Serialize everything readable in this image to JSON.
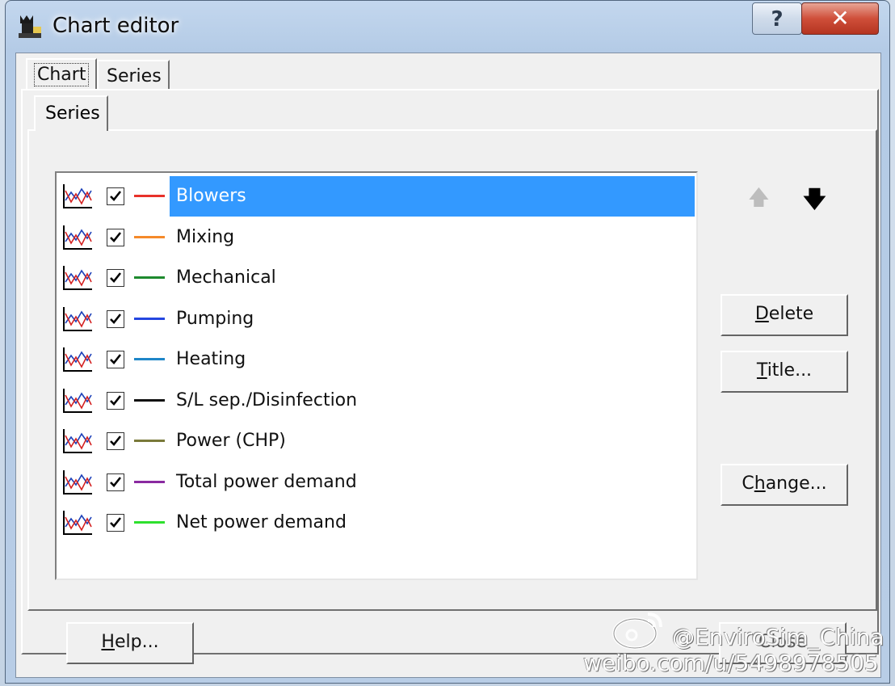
{
  "window": {
    "title": "Chart editor",
    "help_glyph": "?",
    "close_glyph": "✕"
  },
  "tabs": [
    {
      "label": "Chart",
      "active": true
    },
    {
      "label": "Series",
      "active": false
    }
  ],
  "inner_tab": {
    "label": "Series"
  },
  "series_list": [
    {
      "label": "Blowers",
      "color": "#e8322a",
      "checked": true,
      "selected": true
    },
    {
      "label": "Mixing",
      "color": "#f58a2a",
      "checked": true,
      "selected": false
    },
    {
      "label": "Mechanical",
      "color": "#1e8a2e",
      "checked": true,
      "selected": false
    },
    {
      "label": "Pumping",
      "color": "#2446e0",
      "checked": true,
      "selected": false
    },
    {
      "label": "Heating",
      "color": "#1e86c8",
      "checked": true,
      "selected": false
    },
    {
      "label": "S/L sep./Disinfection",
      "color": "#111111",
      "checked": true,
      "selected": false
    },
    {
      "label": "Power (CHP)",
      "color": "#7a7a3a",
      "checked": true,
      "selected": false
    },
    {
      "label": "Total power demand",
      "color": "#8a2aa0",
      "checked": true,
      "selected": false
    },
    {
      "label": "Net power demand",
      "color": "#2ee02e",
      "checked": true,
      "selected": false
    }
  ],
  "move_up_icon": "arrow-up-icon",
  "move_down_icon": "arrow-down-icon",
  "buttons": {
    "delete": {
      "mnemonic": "D",
      "rest": "elete"
    },
    "title": {
      "mnemonic": "T",
      "rest": "itle..."
    },
    "change": {
      "pre": "C",
      "mnemonic": "h",
      "rest": "ange..."
    },
    "help": {
      "mnemonic": "H",
      "rest": "elp..."
    },
    "close": {
      "label": "Close"
    }
  },
  "watermark": {
    "line1": "@EnviroSim_China",
    "line2": "weibo.com/u/5498978505"
  }
}
